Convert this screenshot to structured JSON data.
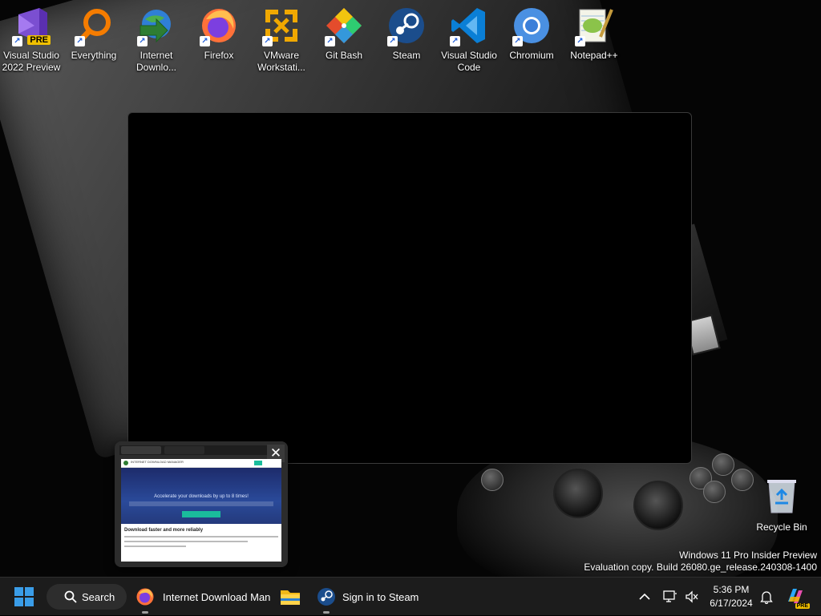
{
  "desktop_icons": [
    {
      "label": "Visual Studio\n2022 Preview",
      "icon": "visual-studio-preview-icon"
    },
    {
      "label": "Everything",
      "icon": "everything-search-icon"
    },
    {
      "label": "Internet\nDownlo...",
      "icon": "internet-download-manager-icon"
    },
    {
      "label": "Firefox",
      "icon": "firefox-icon"
    },
    {
      "label": "VMware\nWorkstati...",
      "icon": "vmware-icon"
    },
    {
      "label": "Git Bash",
      "icon": "git-bash-icon"
    },
    {
      "label": "Steam",
      "icon": "steam-icon"
    },
    {
      "label": "Visual Studio\nCode",
      "icon": "vscode-icon"
    },
    {
      "label": "Chromium",
      "icon": "chromium-icon"
    },
    {
      "label": "Notepad++",
      "icon": "notepadpp-icon"
    }
  ],
  "pre_badge": "PRE",
  "recycle_bin": {
    "label": "Recycle Bin"
  },
  "watermark": {
    "line1": "Windows 11 Pro Insider Preview",
    "line2": "Evaluation copy. Build 26080.ge_release.240308-1400"
  },
  "thumbnail": {
    "close_glyph": "✕",
    "site_title": "INTERNET DOWNLOAD MANAGER",
    "hero_heading": "Accelerate your downloads by up to 8 times!",
    "section_heading": "Download faster and more reliably"
  },
  "taskbar": {
    "search_label": "Search",
    "apps": [
      {
        "label": "Internet Download Man",
        "icon": "firefox-icon"
      },
      {
        "label": "",
        "icon": "file-explorer-icon"
      },
      {
        "label": "Sign in to Steam",
        "icon": "steam-icon"
      }
    ],
    "time": "5:36 PM",
    "date": "6/17/2024",
    "copilot_badge": "PRE"
  },
  "colors": {
    "taskbar": "#1c1c1c",
    "accent": "#0078d4"
  }
}
